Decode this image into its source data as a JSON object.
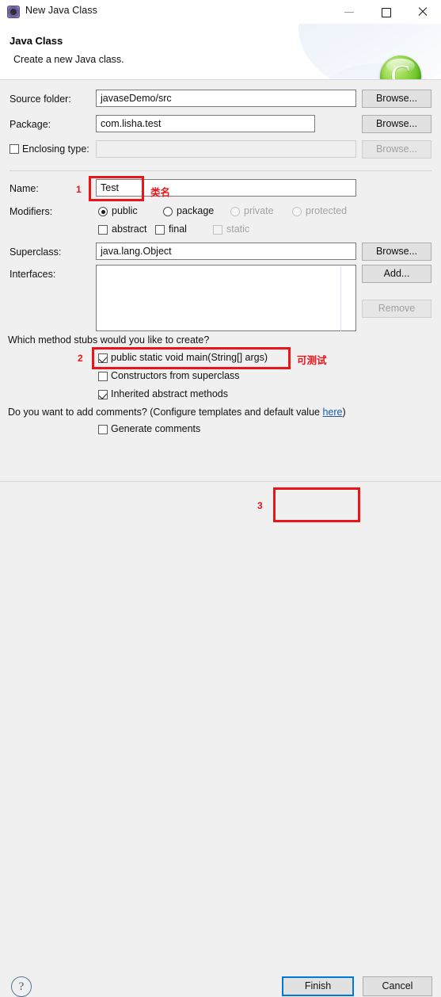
{
  "window": {
    "title": "New Java Class",
    "icon": "eclipse-class-icon",
    "controls": {
      "minimize": "minimize-icon",
      "maximize": "maximize-icon",
      "close": "close-icon"
    }
  },
  "banner": {
    "title": "Java Class",
    "subtitle": "Create a new Java class.",
    "logo_letter": "C",
    "logo_color": "#7cc92a"
  },
  "form": {
    "source_folder": {
      "label": "Source folder:",
      "value": "javaseDemo/src",
      "button": "Browse..."
    },
    "package": {
      "label": "Package:",
      "value": "com.lisha.test",
      "button": "Browse..."
    },
    "enclosing_type": {
      "label": "Enclosing type:",
      "value": "",
      "checked": false,
      "button": "Browse...",
      "disabled": true
    },
    "name": {
      "label": "Name:",
      "value": "Test"
    },
    "modifiers": {
      "label": "Modifiers:",
      "radios": [
        {
          "label": "public",
          "checked": true,
          "disabled": false
        },
        {
          "label": "package",
          "checked": false,
          "disabled": false
        },
        {
          "label": "private",
          "checked": false,
          "disabled": true
        },
        {
          "label": "protected",
          "checked": false,
          "disabled": true
        }
      ],
      "checkboxes": [
        {
          "label": "abstract",
          "checked": false,
          "disabled": false
        },
        {
          "label": "final",
          "checked": false,
          "disabled": false
        },
        {
          "label": "static",
          "checked": false,
          "disabled": true
        }
      ]
    },
    "superclass": {
      "label": "Superclass:",
      "value": "java.lang.Object",
      "button": "Browse..."
    },
    "interfaces": {
      "label": "Interfaces:",
      "items": [],
      "add_button": "Add...",
      "remove_button": "Remove",
      "remove_disabled": true
    },
    "stubs": {
      "question": "Which method stubs would you like to create?",
      "options": [
        {
          "label": "public static void main(String[] args)",
          "checked": true
        },
        {
          "label": "Constructors from superclass",
          "checked": false
        },
        {
          "label": "Inherited abstract methods",
          "checked": true
        }
      ]
    },
    "comments": {
      "question_before": "Do you want to add comments? (Configure templates and default value ",
      "link": "here",
      "question_after": ")",
      "option": {
        "label": "Generate comments",
        "checked": false
      }
    }
  },
  "footer": {
    "help": "?",
    "finish": "Finish",
    "cancel": "Cancel"
  },
  "annotations": {
    "marker1": "1",
    "marker2": "2",
    "marker3": "3",
    "note_name": "类名",
    "note_main": "可测试",
    "color": "#e8161a"
  }
}
